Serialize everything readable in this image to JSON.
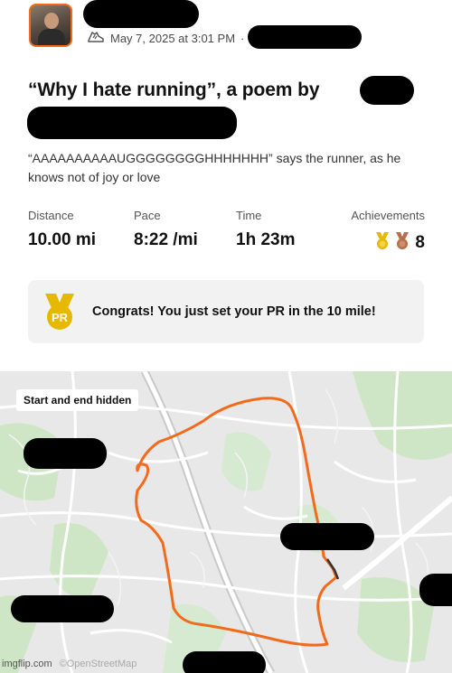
{
  "post": {
    "date_time": "May 7, 2025 at 3:01 PM",
    "separator": "·",
    "title": "“Why I hate running”, a poem by",
    "description": "“AAAAAAAAAAUGGGGGGGGHHHHHHH” says the runner, as he knows not of joy or love"
  },
  "stats": {
    "distance": {
      "label": "Distance",
      "value": "10.00 mi"
    },
    "pace": {
      "label": "Pace",
      "value": "8:22 /mi"
    },
    "time": {
      "label": "Time",
      "value": "1h 23m"
    },
    "achievements": {
      "label": "Achievements",
      "value": "8"
    }
  },
  "pr_card": {
    "badge": "PR",
    "message": "Congrats! You just set your PR in the 10 mile!"
  },
  "map": {
    "tag": "Start and end hidden",
    "watermark": "imgflip.com",
    "attribution": "©OpenStreetMap"
  },
  "colors": {
    "route": "#f26a1b",
    "gold": "#e6b800",
    "bronze": "#b5704a",
    "card_bg": "#f2f2f2"
  },
  "icons": {
    "activity": "running-shoe-icon",
    "medal": "pr-medal-icon",
    "achievement_gold": "gold-trophy-icon",
    "achievement_bronze": "bronze-trophy-icon"
  }
}
